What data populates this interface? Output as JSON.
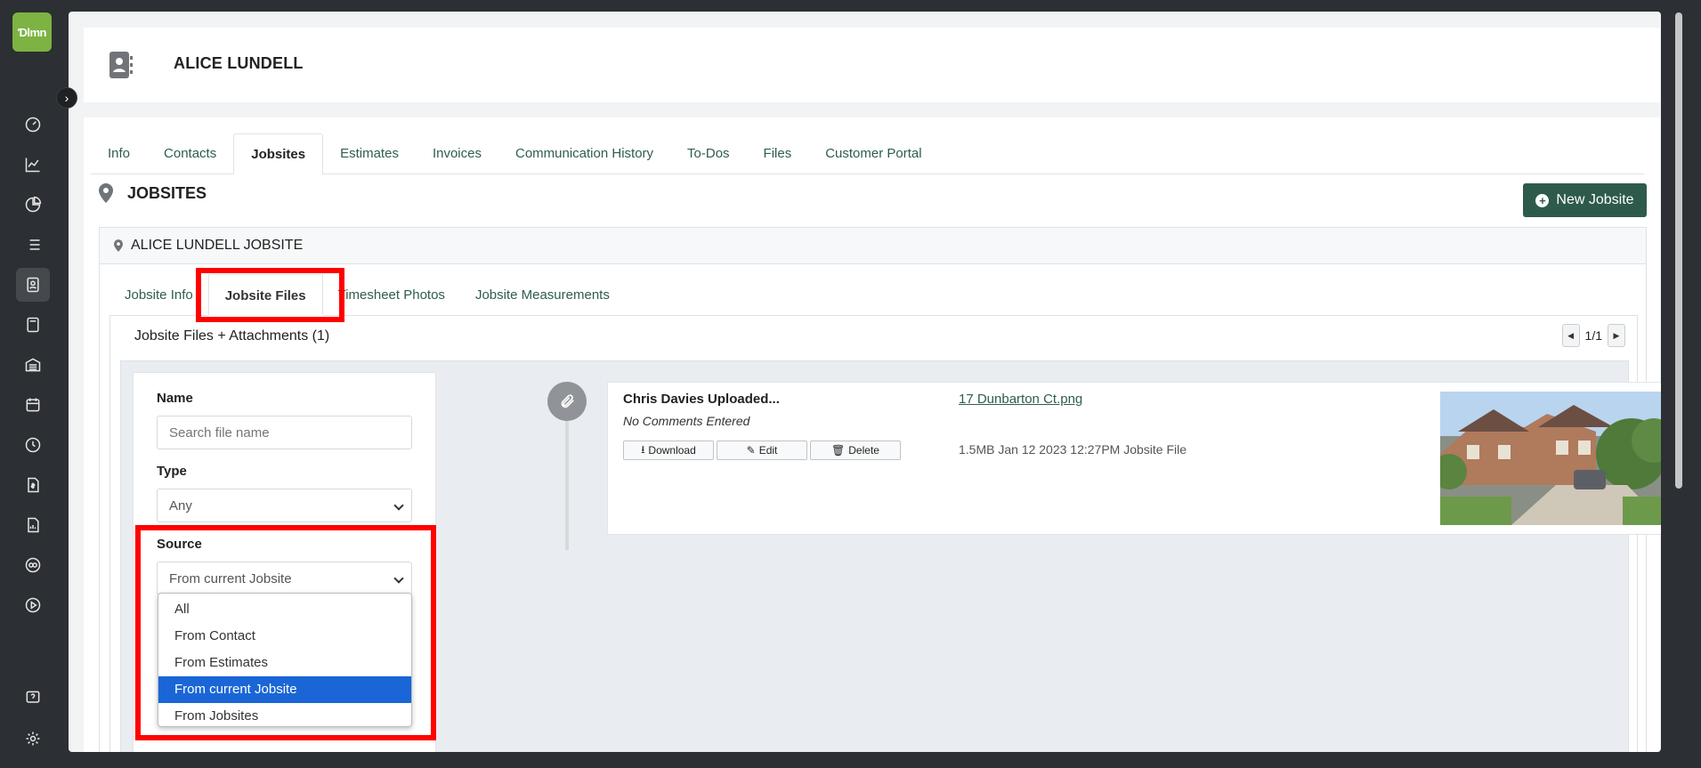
{
  "app": {
    "logo_text": "Ɗlmn"
  },
  "rail": {
    "icons": [
      "dashboard-icon",
      "line-chart-icon",
      "pie-chart-icon",
      "list-icon",
      "contact-card-icon",
      "calculator-icon",
      "warehouse-icon",
      "calendar-icon",
      "clock-icon",
      "invoice-icon",
      "report-icon",
      "quickbooks-icon",
      "play-icon",
      "help-icon",
      "gear-icon"
    ],
    "active": "contact-card-icon"
  },
  "header": {
    "title": "ALICE LUNDELL"
  },
  "tabs": [
    {
      "label": "Info"
    },
    {
      "label": "Contacts"
    },
    {
      "label": "Jobsites",
      "active": true
    },
    {
      "label": "Estimates"
    },
    {
      "label": "Invoices"
    },
    {
      "label": "Communication History"
    },
    {
      "label": "To-Dos"
    },
    {
      "label": "Files"
    },
    {
      "label": "Customer Portal"
    }
  ],
  "jobsites": {
    "heading": "JOBSITES",
    "new_button": "New Jobsite",
    "panel_title": "ALICE LUNDELL JOBSITE"
  },
  "subtabs": [
    {
      "label": "Jobsite Info"
    },
    {
      "label": "Jobsite Files",
      "active": true
    },
    {
      "label": "Timesheet Photos"
    },
    {
      "label": "Jobsite Measurements"
    }
  ],
  "files": {
    "title": "Jobsite Files + Attachments (1)",
    "pager": "1/1"
  },
  "filters": {
    "name_label": "Name",
    "name_placeholder": "Search file name",
    "type_label": "Type",
    "type_value": "Any",
    "source_label": "Source",
    "source_value": "From current Jobsite",
    "source_options": [
      "All",
      "From Contact",
      "From Estimates",
      "From current Jobsite",
      "From Jobsites"
    ]
  },
  "file_item": {
    "user": "Chris Davies Uploaded...",
    "comment": "No Comments Entered",
    "download": "Download",
    "edit": "Edit",
    "delete": "Delete",
    "filename": "17 Dunbarton Ct.png",
    "meta": "1.5MB Jan 12 2023 12:27PM Jobsite File"
  },
  "colors": {
    "accent": "#2e5a4c",
    "logo": "#7cb342",
    "highlight": "#ff0000",
    "selected": "#1a66d6"
  }
}
